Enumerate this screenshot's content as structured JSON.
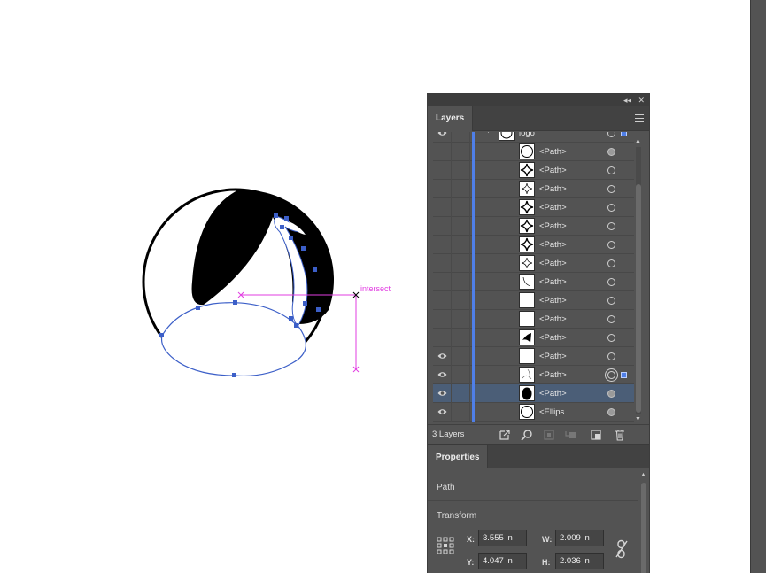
{
  "canvas": {
    "smart_guide_label": "intersect",
    "guide_color": "#e23ee2",
    "path_color": "#3c5fc8"
  },
  "panel": {
    "collapse_icon": "double-chevron-left-icon",
    "close_icon": "close-icon"
  },
  "layers": {
    "tab_label": "Layers",
    "menu_icon": "hamburger-menu-icon",
    "rows": [
      {
        "name": "logo",
        "visible": true,
        "thumb": "logo",
        "target": "empty"
      },
      {
        "name": "<Path>",
        "visible": false,
        "thumb": "circle",
        "target": "filled"
      },
      {
        "name": "<Path>",
        "visible": false,
        "thumb": "sparkle",
        "target": "empty"
      },
      {
        "name": "<Path>",
        "visible": false,
        "thumb": "sparkle-thin",
        "target": "empty"
      },
      {
        "name": "<Path>",
        "visible": false,
        "thumb": "sparkle",
        "target": "empty"
      },
      {
        "name": "<Path>",
        "visible": false,
        "thumb": "sparkle",
        "target": "empty"
      },
      {
        "name": "<Path>",
        "visible": false,
        "thumb": "sparkle",
        "target": "empty"
      },
      {
        "name": "<Path>",
        "visible": false,
        "thumb": "sparkle-thin",
        "target": "empty"
      },
      {
        "name": "<Path>",
        "visible": false,
        "thumb": "curve",
        "target": "empty"
      },
      {
        "name": "<Path>",
        "visible": false,
        "thumb": "blank",
        "target": "empty"
      },
      {
        "name": "<Path>",
        "visible": false,
        "thumb": "blank",
        "target": "empty"
      },
      {
        "name": "<Path>",
        "visible": false,
        "thumb": "wedge",
        "target": "empty"
      },
      {
        "name": "<Path>",
        "visible": true,
        "thumb": "blank",
        "target": "empty"
      },
      {
        "name": "<Path>",
        "visible": true,
        "thumb": "swoosh",
        "target": "double",
        "selected_art": true
      },
      {
        "name": "<Path>",
        "visible": true,
        "thumb": "black-oval",
        "target": "filled",
        "row_selected": true
      },
      {
        "name": "<Ellips...",
        "visible": true,
        "thumb": "circle",
        "target": "filled"
      }
    ],
    "footer": {
      "count_label": "3 Layers",
      "icons": [
        "export-icon",
        "search-icon",
        "clipping-mask-icon",
        "sublayer-icon",
        "new-layer-icon",
        "trash-icon"
      ]
    }
  },
  "properties": {
    "tab_label": "Properties",
    "object_type": "Path",
    "transform_label": "Transform",
    "reference_point_icon": "reference-point-grid-icon",
    "constrain_icon": "link-proportions-icon",
    "x_label": "X:",
    "x_value": "3.555 in",
    "y_label": "Y:",
    "y_value": "4.047 in",
    "w_label": "W:",
    "w_value": "2.009 in",
    "h_label": "H:",
    "h_value": "2.036 in"
  }
}
